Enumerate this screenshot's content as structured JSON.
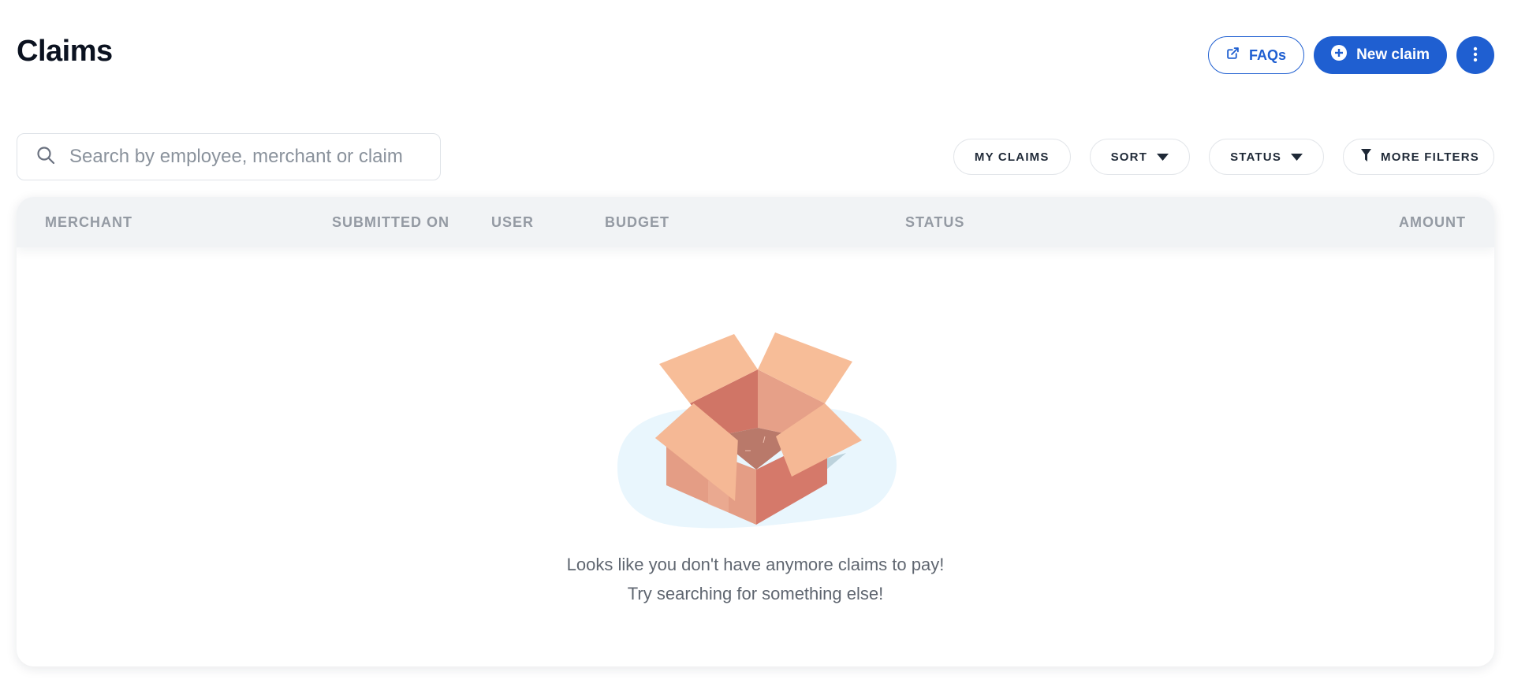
{
  "header": {
    "title": "Claims",
    "faqs_label": "FAQs",
    "new_claim_label": "New claim"
  },
  "search": {
    "placeholder": "Search by employee, merchant or claim"
  },
  "filters": {
    "my_claims": "MY CLAIMS",
    "sort": "SORT",
    "status": "STATUS",
    "more_filters": "MORE FILTERS"
  },
  "table": {
    "columns": [
      "MERCHANT",
      "SUBMITTED ON",
      "USER",
      "BUDGET",
      "STATUS",
      "AMOUNT"
    ]
  },
  "empty_state": {
    "line1": "Looks like you don't have anymore claims to pay!",
    "line2": "Try searching for something else!"
  },
  "icons": {
    "faqs": "external-link-icon",
    "new_claim": "plus-circle-icon",
    "more": "vertical-dots-icon",
    "search": "search-icon",
    "sort": "caret-down-icon",
    "status": "caret-down-icon",
    "more_filters": "funnel-icon"
  },
  "colors": {
    "primary": "#1f5fd1",
    "header_bg": "#f1f3f5",
    "muted_text": "#949aa3"
  }
}
